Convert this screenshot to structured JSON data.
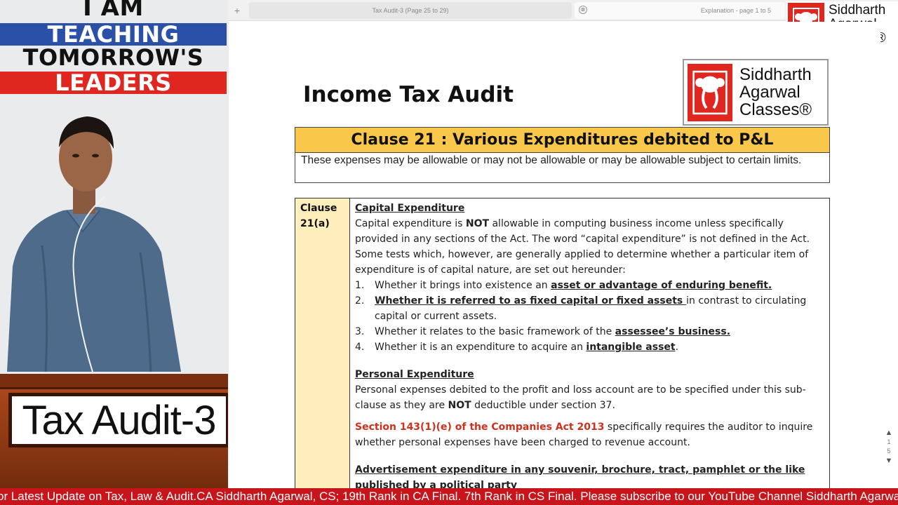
{
  "banner": {
    "line1": "I AM",
    "line2": "TEACHING",
    "line3": "TOMORROW'S",
    "line4": "LEADERS",
    "colors": {
      "blue": "#2b50a8",
      "red": "#e0271f"
    }
  },
  "podium": {
    "label": "Tax Audit-3"
  },
  "browser": {
    "new_tab_icon": "+",
    "tabs": [
      {
        "title": "Tax Audit-3 (Page 25 to 29)"
      },
      {
        "title": "Explanation - page 1 to 5",
        "close_icon": "⊗"
      }
    ]
  },
  "brand": {
    "line1": "Siddharth",
    "line2": "Agarwal",
    "line3": "Classes®",
    "color": "#e0271f"
  },
  "document": {
    "title": "Income Tax Audit",
    "clause_header": "Clause 21 : Various Expenditures debited to P&L",
    "clause_desc": "These expenses may be allowable or may not be allowable or may be allowable subject to certain limits.",
    "clause_cell": {
      "line1": "Clause",
      "line2": "21(a)"
    },
    "capital": {
      "heading": "Capital Expenditure",
      "p_a": "Capital expenditure is ",
      "p_b": "NOT",
      "p_c": " allowable in computing business income unless specifically provided in any sections of the Act. The word “capital expenditure” is not defined in the Act. Some tests which, however, are generally applied to determine whether a particular item of expenditure is of capital nature, are set out hereunder:",
      "items": [
        {
          "num": "1.",
          "pre": "Whether it brings into existence an ",
          "hl": "asset or advantage of enduring benefit.",
          "post": ""
        },
        {
          "num": "2.",
          "pre": "",
          "hl": "Whether it is referred to as fixed capital or fixed assets ",
          "post": "in contrast to circulating capital or current assets."
        },
        {
          "num": "3.",
          "pre": "Whether it relates to the basic framework of the ",
          "hl": "assessee’s business.",
          "post": ""
        },
        {
          "num": "4.",
          "pre": "Whether it is an expenditure to acquire an ",
          "hl": "intangible asset",
          "post": "."
        }
      ]
    },
    "personal": {
      "heading": "Personal Expenditure",
      "p_a": "Personal expenses debited to the profit and loss account are to be specified under this sub-clause as they are ",
      "p_b": "NOT",
      "p_c": " deductible under section 37.",
      "red": "Section 143(1)(e) of the Companies Act 2013",
      "p_d": " specifically requires the auditor to inquire whether personal expenses have been charged to revenue account."
    },
    "advert": {
      "heading": "Advertisement expenditure in any souvenir, brochure, tract, pamphlet or the like published by a political party"
    }
  },
  "pager": {
    "up_icon": "▲",
    "current": "1",
    "total": "5",
    "down_icon": "▼"
  },
  "ticker": {
    "text": "or Latest Update on Tax, Law & Audit.CA Siddharth Agarwal, CS; 19th Rank in CA Final. 7th Rank in CS Final. Please subscribe to our YouTube Channel Siddharth Agarwal Classes f"
  }
}
